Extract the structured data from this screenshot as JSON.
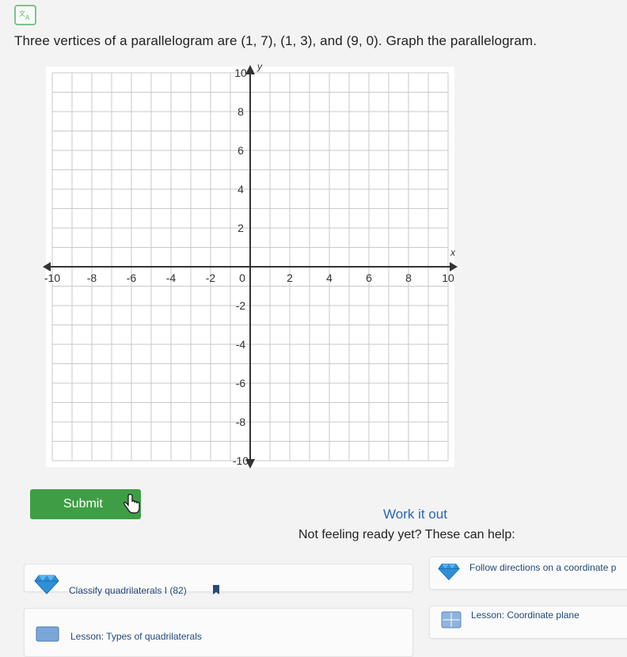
{
  "question": {
    "translate_icon": "translate-icon",
    "text": "Three vertices of a parallelogram are (1, 7), (1, 3), and (9, 0). Graph the parallelogram."
  },
  "graph": {
    "x_ticks": [
      "-10",
      "-8",
      "-6",
      "-4",
      "-2",
      "0",
      "2",
      "4",
      "6",
      "8",
      "10"
    ],
    "y_ticks": [
      "10",
      "8",
      "6",
      "4",
      "2",
      "-2",
      "-4",
      "-6",
      "-8",
      "-10"
    ],
    "x_label": "x",
    "y_label": "y",
    "xlim": [
      -10,
      10
    ],
    "ylim": [
      -10,
      10
    ]
  },
  "actions": {
    "submit_label": "Submit",
    "work_it_out": "Work it out",
    "help_prompt": "Not feeling ready yet? These can help:"
  },
  "resources": [
    {
      "label": "Classify quadrilaterals I (82)",
      "icon": "diamond-icon"
    },
    {
      "label": "Follow directions on a coordinate p",
      "icon": "diamond-icon"
    },
    {
      "label": "Lesson: Types of quadrilaterals",
      "icon": "lesson-icon"
    },
    {
      "label": "Lesson: Coordinate plane",
      "icon": "lesson-icon"
    }
  ],
  "colors": {
    "submit": "#3f9e45",
    "link": "#2a66b6",
    "gem": "#2f8fd6"
  }
}
